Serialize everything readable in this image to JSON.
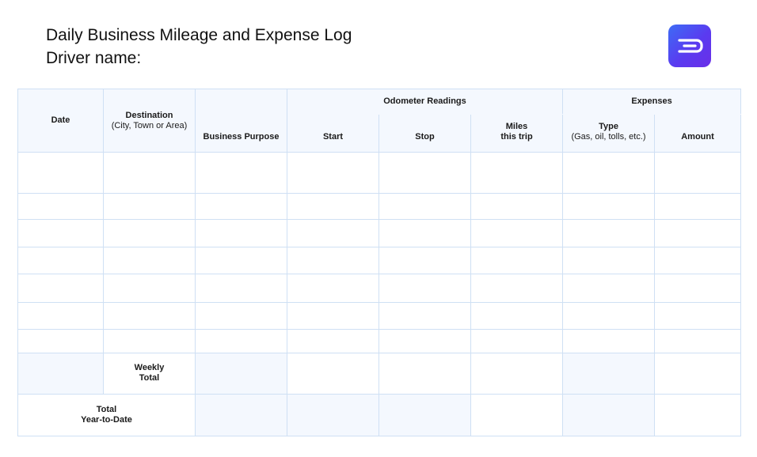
{
  "header": {
    "title": "Daily Business Mileage and Expense Log",
    "driver_label": "Driver name:"
  },
  "logo": {
    "icon": "brand-logo-icon",
    "color_start": "#3d6cf5",
    "color_end": "#6a2ee8"
  },
  "table": {
    "col_date": "Date",
    "col_destination": "Destination",
    "col_destination_sub": "(City, Town or Area)",
    "col_purpose": "Business Purpose",
    "group_odometer": "Odometer Readings",
    "col_start": "Start",
    "col_stop": "Stop",
    "col_miles_1": "Miles",
    "col_miles_2": "this trip",
    "group_expenses": "Expenses",
    "col_type": "Type",
    "col_type_sub": "(Gas, oil, tolls, etc.)",
    "col_amount": "Amount",
    "weekly_1": "Weekly",
    "weekly_2": "Total",
    "ytd_1": "Total",
    "ytd_2": "Year-to-Date"
  },
  "colors": {
    "border": "#cfe0f4",
    "header_bg": "#f4f8fe"
  }
}
